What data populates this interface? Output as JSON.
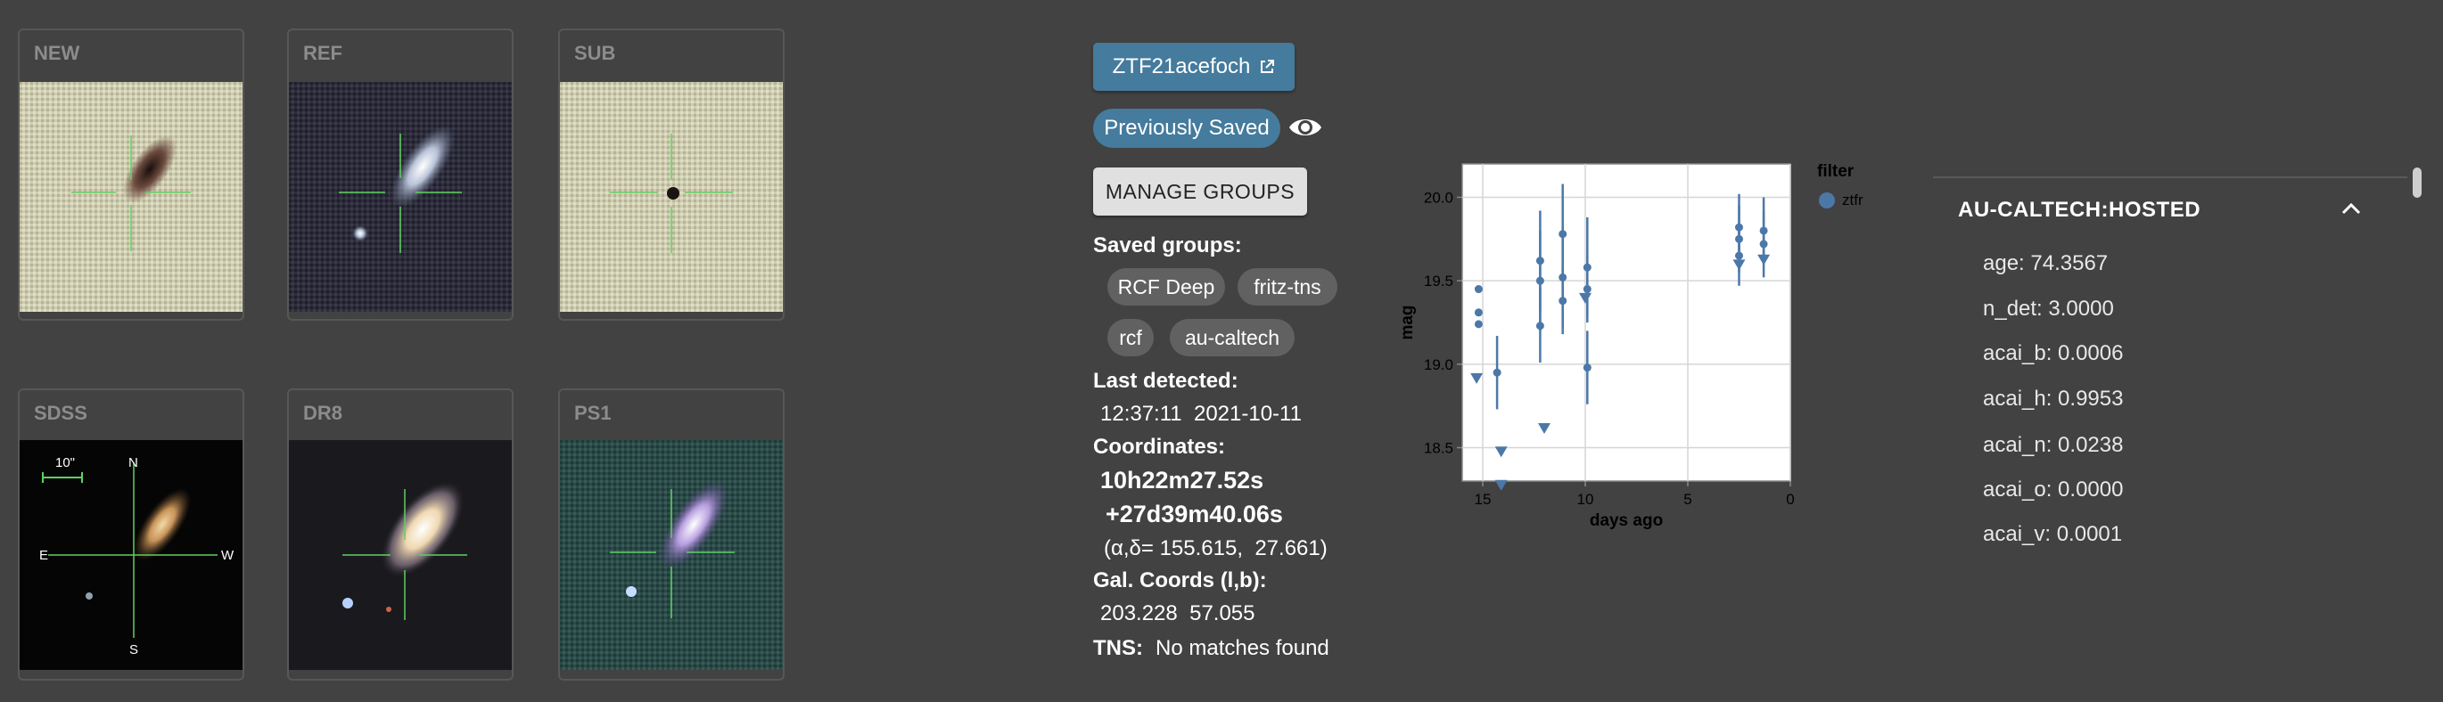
{
  "thumbnails": [
    {
      "label": "NEW"
    },
    {
      "label": "REF"
    },
    {
      "label": "SUB"
    },
    {
      "label": "SDSS",
      "scale_label": "10\"",
      "compass": {
        "n": "N",
        "e": "E",
        "w": "W",
        "s": "S"
      }
    },
    {
      "label": "DR8"
    },
    {
      "label": "PS1"
    }
  ],
  "source": {
    "name": "ZTF21acefoch",
    "link_icon": "external-link-icon",
    "saved_status": "Previously Saved",
    "eye_icon": "eye-icon",
    "manage_groups": "MANAGE GROUPS",
    "saved_groups_label": "Saved groups:",
    "groups": [
      "RCF Deep",
      "fritz-tns",
      "rcf",
      "au-caltech"
    ],
    "last_detected_label": "Last detected:",
    "last_detected": "12:37:11  2021-10-11",
    "coordinates_label": "Coordinates:",
    "ra": "10h22m27.52s",
    "dec": "+27d39m40.06s",
    "radec_deg": "(α,δ= 155.615,  27.661)",
    "gal_label": "Gal. Coords (l,b):",
    "gal": "203.228  57.055",
    "tns_label": "TNS:",
    "tns": "No matches found"
  },
  "chart_data": {
    "type": "scatter",
    "xlabel": "days ago",
    "ylabel": "mag",
    "xlim": [
      16,
      0
    ],
    "ylim": [
      20.2,
      18.3
    ],
    "x_ticks": [
      15,
      10,
      5,
      0
    ],
    "y_ticks": [
      18.5,
      19.0,
      19.5,
      20.0
    ],
    "y_tick_labels": [
      "18.5",
      "19.0",
      "19.5",
      "20.0"
    ],
    "grid": true,
    "legend_title": "filter",
    "series": [
      {
        "name": "ztfr",
        "color": "#4c78a8",
        "detections": [
          {
            "x": 15.2,
            "y": 19.24,
            "err": 0.0
          },
          {
            "x": 15.2,
            "y": 19.31,
            "err": 0.0
          },
          {
            "x": 15.2,
            "y": 19.45,
            "err": 0.0
          },
          {
            "x": 14.3,
            "y": 18.95,
            "err": 0.22
          },
          {
            "x": 12.2,
            "y": 19.23,
            "err": 0.22
          },
          {
            "x": 12.2,
            "y": 19.5,
            "err": 0.3
          },
          {
            "x": 12.2,
            "y": 19.62,
            "err": 0.3
          },
          {
            "x": 11.1,
            "y": 19.38,
            "err": 0.2
          },
          {
            "x": 11.1,
            "y": 19.52,
            "err": 0.3
          },
          {
            "x": 11.1,
            "y": 19.78,
            "err": 0.3
          },
          {
            "x": 9.9,
            "y": 18.98,
            "err": 0.22
          },
          {
            "x": 9.9,
            "y": 19.45,
            "err": 0.2
          },
          {
            "x": 9.9,
            "y": 19.58,
            "err": 0.3
          },
          {
            "x": 2.5,
            "y": 19.65,
            "err": 0.18
          },
          {
            "x": 2.5,
            "y": 19.75,
            "err": 0.2
          },
          {
            "x": 2.5,
            "y": 19.82,
            "err": 0.2
          },
          {
            "x": 1.3,
            "y": 19.72,
            "err": 0.2
          },
          {
            "x": 1.3,
            "y": 19.8,
            "err": 0.2
          }
        ],
        "upper_limits": [
          {
            "x": 15.3,
            "y": 18.92
          },
          {
            "x": 14.1,
            "y": 18.28
          },
          {
            "x": 14.1,
            "y": 18.48
          },
          {
            "x": 12.0,
            "y": 18.62
          },
          {
            "x": 10.0,
            "y": 19.4
          },
          {
            "x": 2.5,
            "y": 19.6
          },
          {
            "x": 1.3,
            "y": 19.63
          }
        ]
      }
    ]
  },
  "panel": {
    "title": "AU-CALTECH:HOSTED",
    "chevron_icon": "chevron-up-icon",
    "rows": [
      "age: 74.3567",
      "n_det: 3.0000",
      "acai_b: 0.0006",
      "acai_h: 0.9953",
      "acai_n: 0.0238",
      "acai_o: 0.0000",
      "acai_v: 0.0001"
    ]
  }
}
